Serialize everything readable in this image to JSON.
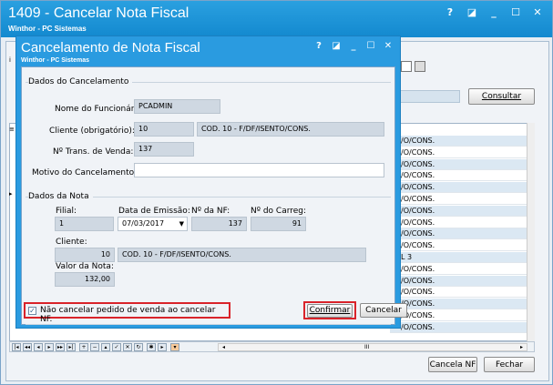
{
  "main": {
    "title": "1409 - Cancelar Nota Fiscal",
    "subtitle": "Winthor - PC Sistemas",
    "window_buttons": [
      "?",
      "◪",
      "_",
      "☐",
      "✕"
    ],
    "consultar_label": "Consultar",
    "cancela_nf_label": "Cancela NF",
    "fechar_label": "Fechar",
    "grid_rows": [
      "/O/CONS.",
      "/O/CONS.",
      "/O/CONS.",
      "/O/CONS.",
      "/O/CONS.",
      "/O/CONS.",
      "/O/CONS.",
      "/O/CONS.",
      "/O/CONS.",
      "/O/CONS.",
      "L 3",
      "/O/CONS.",
      "/O/CONS.",
      "/O/CONS.",
      "/O/CONS.",
      "/O/CONS.",
      "/O/CONS."
    ],
    "hscroll_thumb": "III",
    "left_markers": [
      "i",
      "≡",
      "▸"
    ]
  },
  "dialog": {
    "title": "Cancelamento de Nota Fiscal",
    "subtitle": "Winthor - PC Sistemas",
    "window_buttons": [
      "?",
      "◪",
      "_",
      "☐",
      "✕"
    ],
    "dados_cancelamento": {
      "group_title": "Dados do Cancelamento",
      "nome_label": "Nome do Funcionário:",
      "nome_value": "PCADMIN",
      "cliente_label": "Cliente (obrigatório):",
      "cliente_code": "10",
      "cliente_desc": "COD. 10 - F/DF/ISENTO/CONS.",
      "trans_label": "Nº Trans. de Venda:",
      "trans_value": "137",
      "motivo_label": "Motivo do Cancelamento:",
      "motivo_value": ""
    },
    "dados_nota": {
      "group_title": "Dados da Nota",
      "filial_label": "Filial:",
      "filial_value": "1",
      "data_label": "Data de Emissão:",
      "data_value": "07/03/2017",
      "nf_label": "Nº da NF:",
      "nf_value": "137",
      "carreg_label": "Nº do Carreg:",
      "carreg_value": "91",
      "cliente_label": "Cliente:",
      "cliente_code": "10",
      "cliente_desc": "COD. 10 - F/DF/ISENTO/CONS.",
      "valor_label": "Valor da Nota:",
      "valor_value": "132,00"
    },
    "checkbox_label": "Não cancelar pedido de venda ao cancelar NF.",
    "checkbox_checked": true,
    "confirmar_label": "Confirmar",
    "cancelar_label": "Cancelar"
  }
}
